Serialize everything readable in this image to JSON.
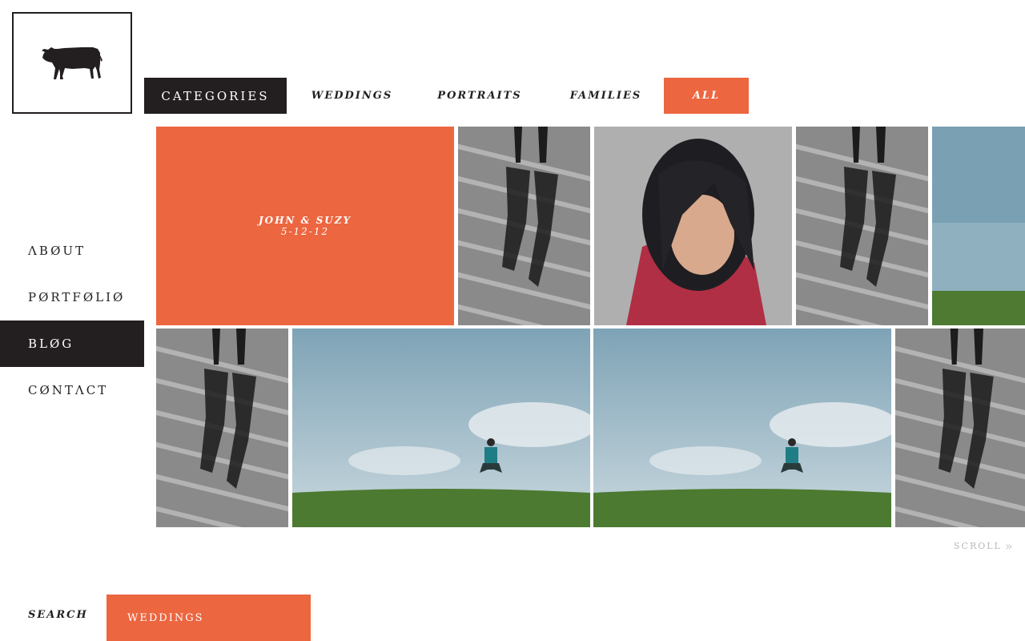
{
  "brand": {
    "logo_icon": "cow-silhouette-icon"
  },
  "topnav": {
    "categories_label": "CATEGORIES",
    "tabs": [
      {
        "label": "WEDDINGS"
      },
      {
        "label": "PORTRAITS"
      },
      {
        "label": "FAMILIES"
      },
      {
        "label": "ALL",
        "active": true
      }
    ]
  },
  "sidenav": {
    "items": [
      {
        "label": "ΛBØUT"
      },
      {
        "label": "PØRTFØLIØ"
      },
      {
        "label": "BLØG",
        "active": true
      },
      {
        "label": "CØNTΛCT"
      }
    ]
  },
  "gallery": {
    "featured": {
      "title": "JOHN & SUZY",
      "date": "5-12-12"
    },
    "photos": [
      {
        "subject": "wet-boardwalk-reflection"
      },
      {
        "subject": "woman-portrait"
      },
      {
        "subject": "wet-boardwalk-reflection"
      },
      {
        "subject": "sky-grass-field"
      },
      {
        "subject": "wet-boardwalk-reflection"
      },
      {
        "subject": "jumping-man-field"
      },
      {
        "subject": "jumping-man-field"
      },
      {
        "subject": "wet-boardwalk-reflection"
      }
    ]
  },
  "scroll": {
    "label": "SCROLL",
    "icon": "double-chevron-right-icon"
  },
  "search": {
    "label": "SEARCH",
    "value": "WEDDINGS"
  },
  "colors": {
    "accent": "#ec6640",
    "dark": "#231f20",
    "background": "#ffffff"
  }
}
